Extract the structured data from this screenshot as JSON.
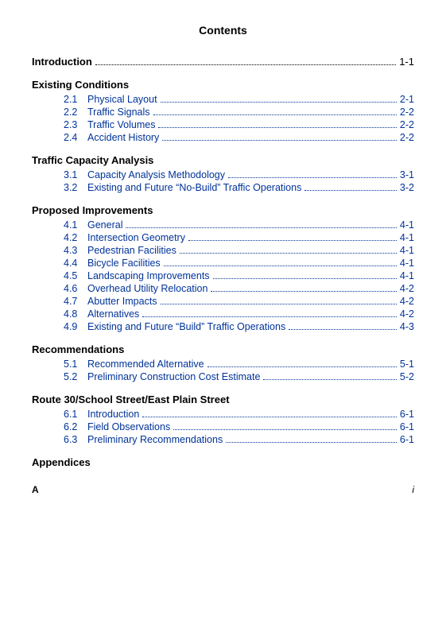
{
  "page": {
    "title": "Contents"
  },
  "intro": {
    "label": "Introduction",
    "dots": "dotted",
    "page": "1-1"
  },
  "sections": [
    {
      "id": "existing-conditions",
      "heading": "Existing Conditions",
      "entries": [
        {
          "number": "2.1",
          "title": "Physical Layout",
          "page": "2-1"
        },
        {
          "number": "2.2",
          "title": "Traffic Signals",
          "page": "2-2"
        },
        {
          "number": "2.3",
          "title": "Traffic Volumes",
          "page": "2-2"
        },
        {
          "number": "2.4",
          "title": "Accident History",
          "page": "2-2"
        }
      ]
    },
    {
      "id": "traffic-capacity-analysis",
      "heading": "Traffic Capacity Analysis",
      "entries": [
        {
          "number": "3.1",
          "title": "Capacity Analysis Methodology",
          "page": "3-1"
        },
        {
          "number": "3.2",
          "title": "Existing and Future “No-Build” Traffic Operations",
          "page": "3-2"
        }
      ]
    },
    {
      "id": "proposed-improvements",
      "heading": "Proposed Improvements",
      "entries": [
        {
          "number": "4.1",
          "title": "General",
          "page": "4-1"
        },
        {
          "number": "4.2",
          "title": "Intersection Geometry",
          "page": "4-1"
        },
        {
          "number": "4.3",
          "title": "Pedestrian Facilities",
          "page": "4-1"
        },
        {
          "number": "4.4",
          "title": "Bicycle Facilities",
          "page": "4-1"
        },
        {
          "number": "4.5",
          "title": "Landscaping Improvements",
          "page": "4-1"
        },
        {
          "number": "4.6",
          "title": "Overhead Utility Relocation",
          "page": "4-2"
        },
        {
          "number": "4.7",
          "title": "Abutter Impacts",
          "page": "4-2"
        },
        {
          "number": "4.8",
          "title": "Alternatives",
          "page": "4-2"
        },
        {
          "number": "4.9",
          "title": "Existing and Future “Build” Traffic Operations",
          "page": "4-3"
        }
      ]
    },
    {
      "id": "recommendations",
      "heading": "Recommendations",
      "entries": [
        {
          "number": "5.1",
          "title": "Recommended Alternative",
          "page": "5-1"
        },
        {
          "number": "5.2",
          "title": "Preliminary Construction Cost Estimate",
          "page": "5-2"
        }
      ]
    },
    {
      "id": "route-30",
      "heading": "Route 30/School Street/East Plain Street",
      "entries": [
        {
          "number": "6.1",
          "title": "Introduction",
          "page": "6-1"
        },
        {
          "number": "6.2",
          "title": "Field Observations",
          "page": "6-1"
        },
        {
          "number": "6.3",
          "title": "Preliminary Recommendations",
          "page": "6-1"
        }
      ]
    },
    {
      "id": "appendices",
      "heading": "Appendices",
      "entries": []
    }
  ],
  "footer": {
    "left": "A",
    "right": "i"
  }
}
